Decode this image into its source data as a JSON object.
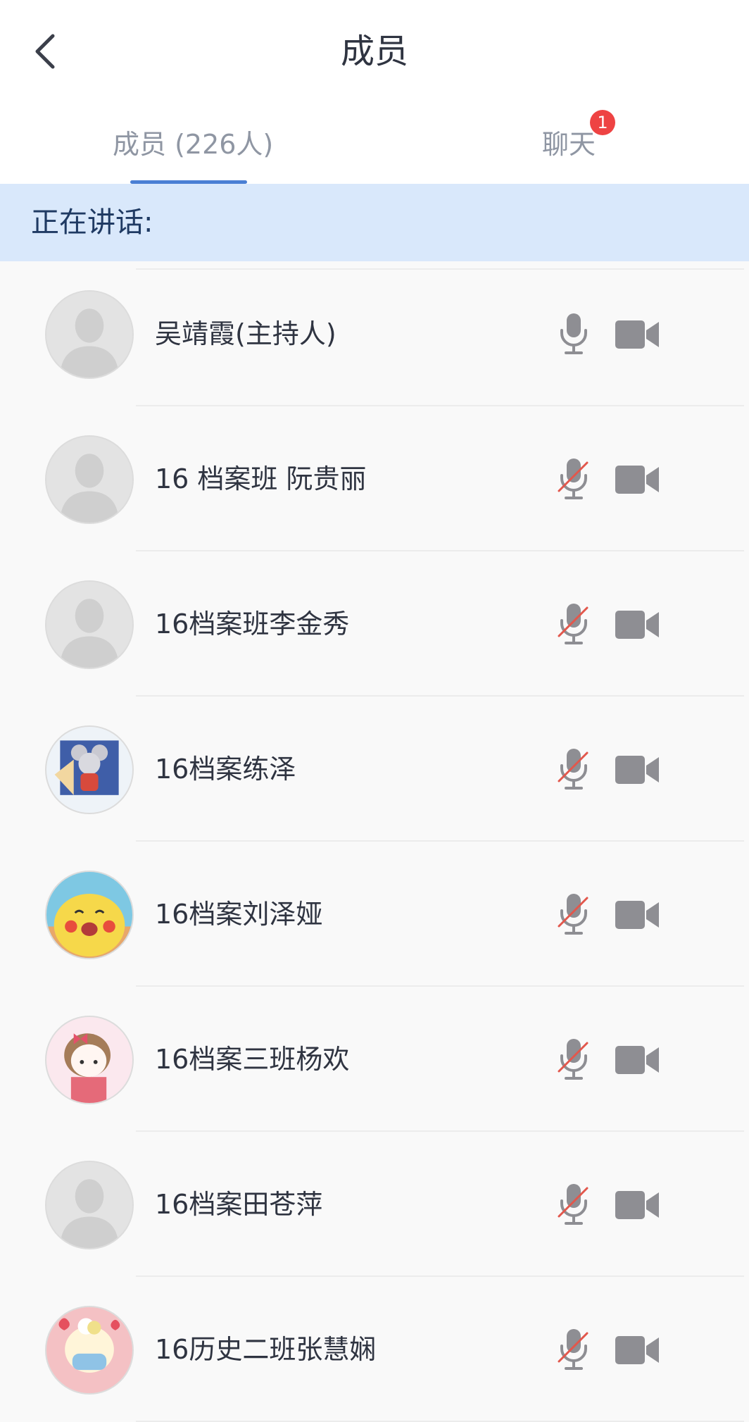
{
  "header": {
    "title": "成员"
  },
  "tabs": [
    {
      "label": "成员 (226人)",
      "active": true
    },
    {
      "label": "聊天",
      "badge": "1"
    }
  ],
  "speaking": {
    "label": "正在讲话:"
  },
  "members": [
    {
      "name": "吴靖霞(主持人)",
      "avatar": "default-avatar",
      "mic": "on",
      "video": "on"
    },
    {
      "name": "16 档案班 阮贵丽",
      "avatar": "default-avatar",
      "mic": "muted",
      "video": "on"
    },
    {
      "name": "16档案班李金秀",
      "avatar": "default-avatar",
      "mic": "muted",
      "video": "on"
    },
    {
      "name": "16档案练泽",
      "avatar": "cartoon-mouse-avatar",
      "mic": "muted",
      "video": "on"
    },
    {
      "name": "16档案刘泽娅",
      "avatar": "pikachu-avatar",
      "mic": "muted",
      "video": "on"
    },
    {
      "name": "16档案三班杨欢",
      "avatar": "cartoon-girl-avatar",
      "mic": "muted",
      "video": "on"
    },
    {
      "name": "16档案田苍萍",
      "avatar": "default-avatar",
      "mic": "muted",
      "video": "on"
    },
    {
      "name": "16历史二班张慧娴",
      "avatar": "cartoon-masked-avatar",
      "mic": "muted",
      "video": "on"
    }
  ],
  "colors": {
    "accent": "#4a7fd4",
    "badge": "#ee4343",
    "speaking_bg": "#d9e8fb",
    "muted_slash": "#e2574c",
    "icon_gray": "#8e8e93"
  }
}
